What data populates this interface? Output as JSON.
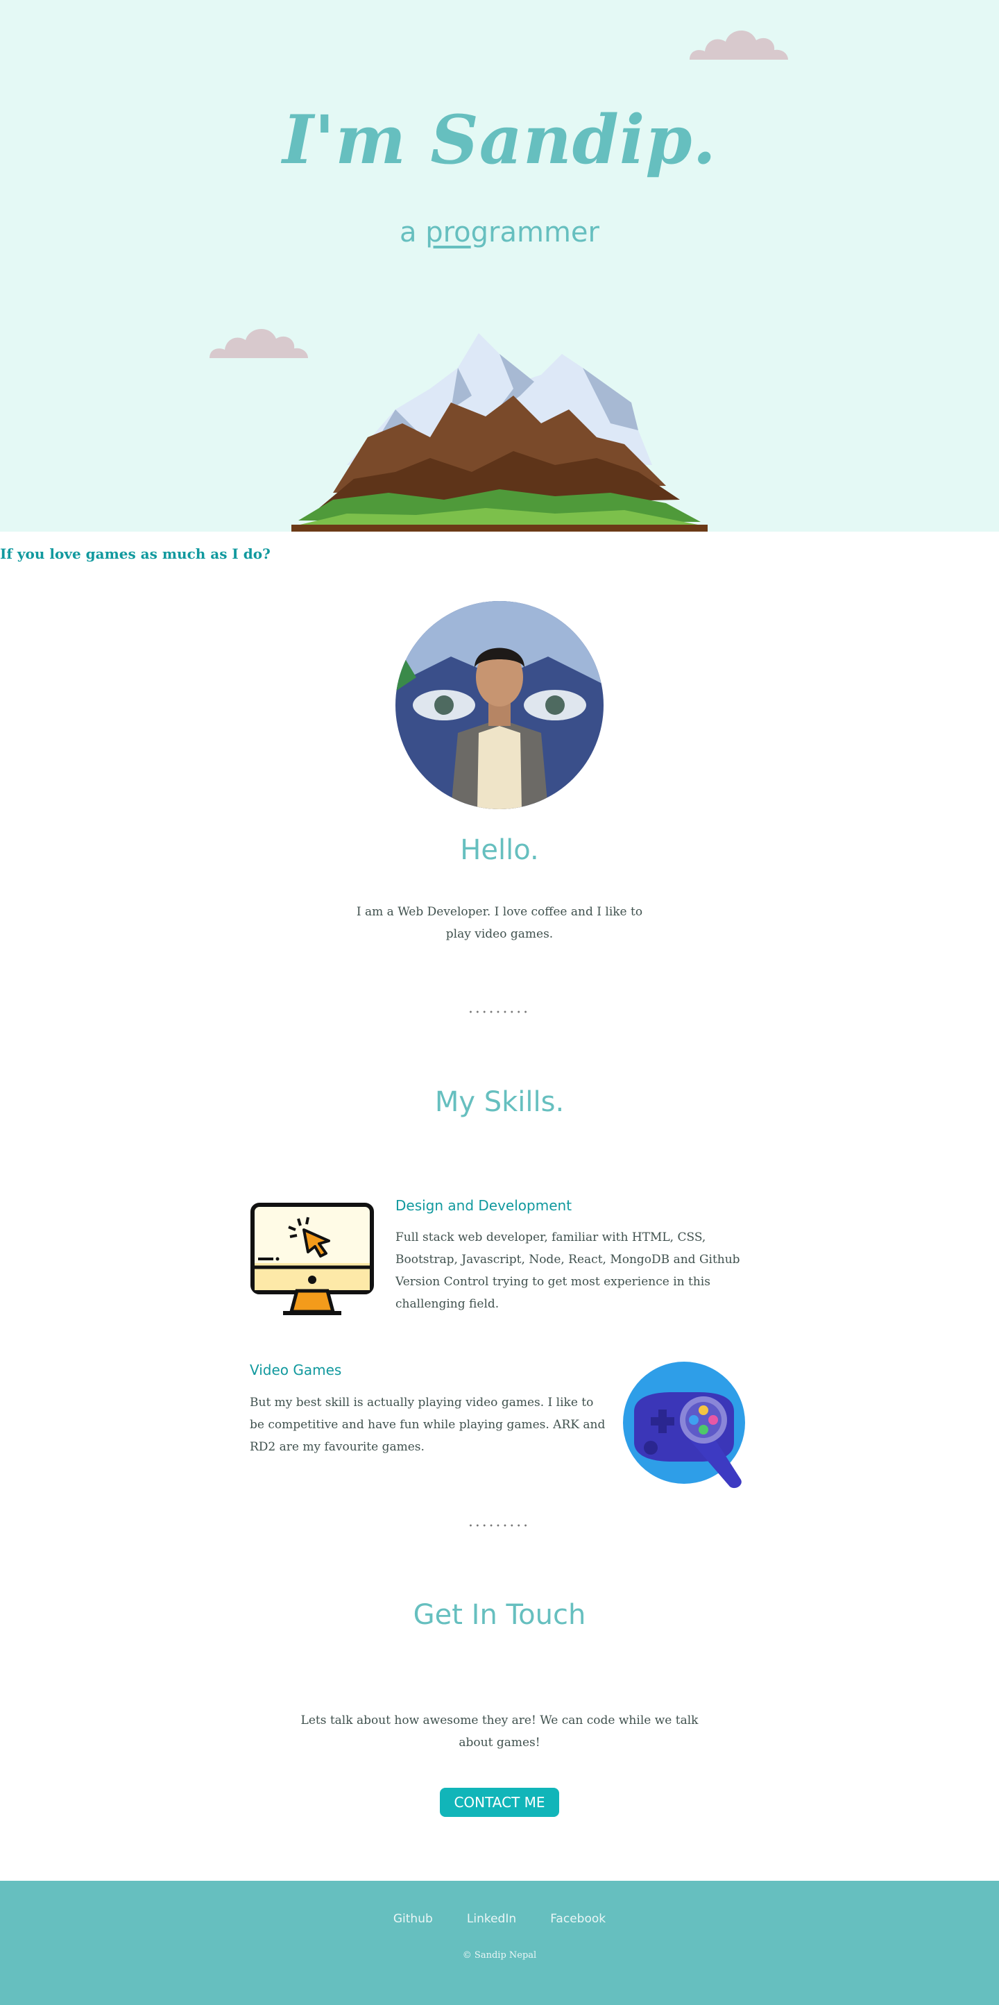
{
  "hero": {
    "title": "I'm Sandip.",
    "subtitle_prefix": "a ",
    "subtitle_underlined": "pro",
    "subtitle_suffix": "grammer"
  },
  "about": {
    "heading": "Hello.",
    "text": "I am a Web Developer. I love coffee and I like to play video games."
  },
  "divider": "•••••••••",
  "skills": {
    "heading": "My Skills.",
    "items": [
      {
        "title": "Design and Development",
        "text": "Full stack web developer, familiar with HTML, CSS, Bootstrap, Javascript, Node, React, MongoDB and Github Version Control trying to get most experience in this challenging field.",
        "icon": "computer-icon"
      },
      {
        "title": "Video Games",
        "text": "But my best skill is actually playing video games. I like to be competitive and have fun while playing games. ARK and RD2 are my favourite games.",
        "icon": "gamepad-icon"
      }
    ]
  },
  "contact": {
    "heading": "Get In Touch",
    "subheading": "If you love games as much as I do?",
    "text": "Lets talk about how awesome they are! We can code while we talk about games!",
    "button": "CONTACT ME"
  },
  "footer": {
    "links": [
      "Github",
      "LinkedIn",
      "Facebook"
    ],
    "copyright": "© Sandip Nepal"
  },
  "colors": {
    "hero_bg": "#e4f9f5",
    "accent": "#66bfbf",
    "accent_dark": "#11999e",
    "button": "#11b5b9",
    "text": "#40514e"
  }
}
